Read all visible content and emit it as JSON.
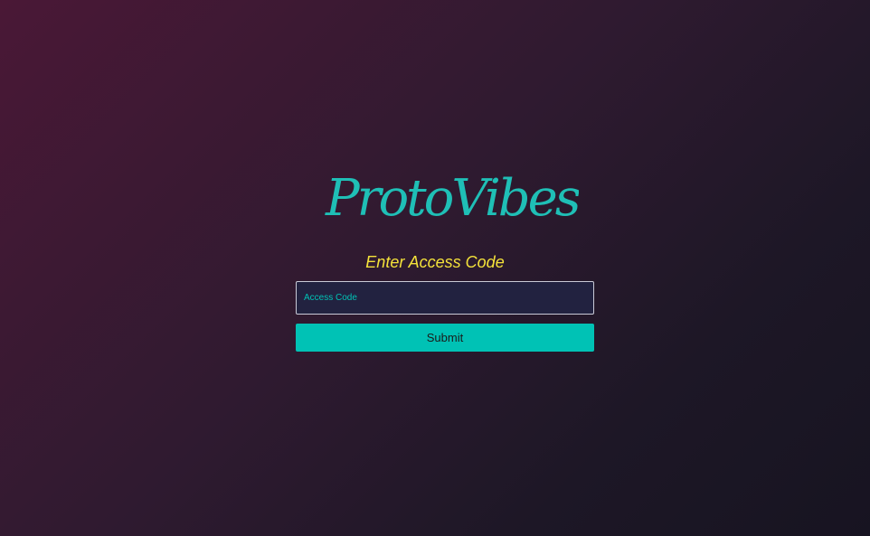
{
  "brand": {
    "name": "ProtoVibes",
    "color": "#1fbfb6"
  },
  "access": {
    "heading": "Enter Access Code",
    "heading_color": "#f4e23a",
    "input_placeholder": "Access Code",
    "input_value": "",
    "submit_label": "Submit",
    "accent_color": "#00c2b5"
  }
}
